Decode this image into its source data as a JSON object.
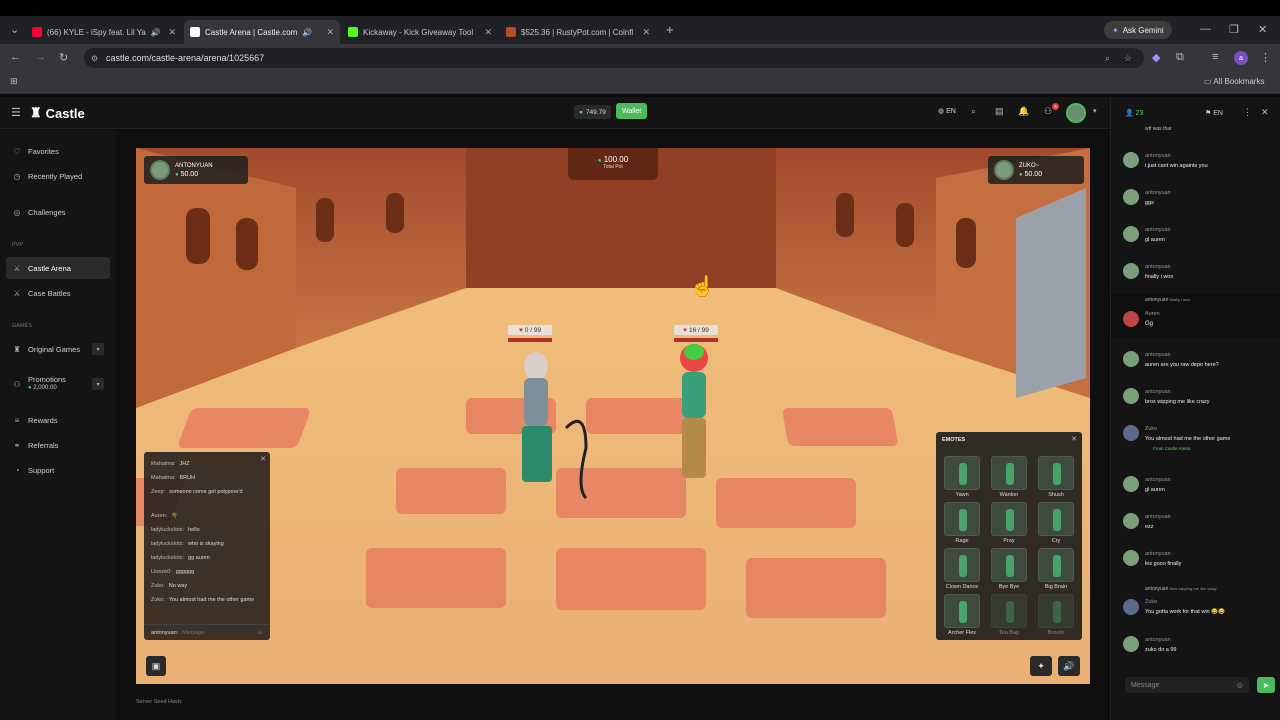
{
  "browser": {
    "tabs": [
      {
        "title": "(66) KYLE - iSpy feat. Lil Ya",
        "fav_color": "#ff0033"
      },
      {
        "title": "Castle Arena | Castle.com",
        "fav_color": "#ffffff"
      },
      {
        "title": "Kickaway - Kick Giveaway Tool",
        "fav_color": "#53fc18"
      },
      {
        "title": "$525.36 | RustyPot.com | Coinfl",
        "fav_color": "#b0502a"
      }
    ],
    "gemini_label": "Ask Gemini",
    "url": "castle.com/castle-arena/arena/1025667",
    "bookmarks_label": "All Bookmarks"
  },
  "header": {
    "logo": "Castle",
    "balance": "749.79",
    "wallet_label": "Wallet",
    "lang": "EN",
    "notif_count": "5"
  },
  "sidebar": {
    "items": [
      "Favorites",
      "Recently Played",
      "Challenges",
      "Castle Arena",
      "Case Battles",
      "Original Games",
      "Promotions",
      "Rewards",
      "Referrals",
      "Support"
    ],
    "pvp_label": "PVP",
    "games_label": "GAMES",
    "promo_amount": "2,000.00"
  },
  "game": {
    "total_pot": "100.00",
    "total_pot_label": "Total Pot",
    "player1": {
      "name": "ANTONYUAN",
      "money": "50.00",
      "hp": "0 / 99"
    },
    "player2": {
      "name": "ZUKO~",
      "money": "50.00",
      "hp": "16 / 99"
    },
    "server_seed": "Server Seed Hash:"
  },
  "game_chat": {
    "lines": [
      {
        "user": "Mahatma:",
        "text": "JHZ"
      },
      {
        "user": "Mahatma:",
        "text": "BRUH"
      },
      {
        "user": "Zeep:",
        "text": "someone come get polypore'd"
      },
      {
        "user": "Auren:",
        "text": "🌴"
      },
      {
        "user": "ladylucksIots:",
        "text": "hello"
      },
      {
        "user": "ladylucksIots:",
        "text": "who is skaying"
      },
      {
        "user": "ladylucksIots:",
        "text": "gg auren"
      },
      {
        "user": "Llonze0:",
        "text": "gggggg"
      },
      {
        "user": "Zuko:",
        "text": "No way"
      },
      {
        "user": "Zuko:",
        "text": "You almost had me the other game"
      }
    ],
    "input_user": "antonyuan:",
    "input_placeholder": "Message"
  },
  "emotes": {
    "title": "EMOTES",
    "items": [
      "Yawn",
      "Wanker",
      "Shush",
      "Rage",
      "Pray",
      "Cry",
      "Clown Dance",
      "Bye Bye",
      "Big Brain",
      "Archer Flex",
      "Tea Bag",
      "Broom"
    ]
  },
  "right_chat": {
    "viewer_count": "23",
    "lang": "EN",
    "top_snippet": "wtf was that",
    "messages": [
      {
        "user": "antonyuan",
        "text": "i just cant win againts you"
      },
      {
        "user": "antonyuan",
        "text": "ggs"
      },
      {
        "user": "antonyuan",
        "text": "gl auren"
      },
      {
        "user": "antonyuan",
        "text": "finally i won"
      },
      {
        "user": "Auren",
        "text": "Gg",
        "reply_user": "antonyuan",
        "reply_text": "finally i won"
      },
      {
        "user": "antonyuan",
        "text": "auren are you raw depo here?"
      },
      {
        "user": "antonyuan",
        "text": "bros wipping me like crazy"
      },
      {
        "user": "Zuko",
        "text": "You almost had me the other game",
        "from": "From Castle Arena"
      },
      {
        "user": "antonyuan",
        "text": "gl auren"
      },
      {
        "user": "antonyuan",
        "text": "ezz"
      },
      {
        "user": "antonyuan",
        "text": "les gooo finally"
      },
      {
        "user": "Zuko",
        "text": "You gotta work for that win 😂😂",
        "reply_user": "antonyuan",
        "reply_text": "bros wipping me like crazy"
      },
      {
        "user": "antonyuan",
        "text": "zuko do a 99"
      }
    ],
    "input_placeholder": "Message"
  }
}
